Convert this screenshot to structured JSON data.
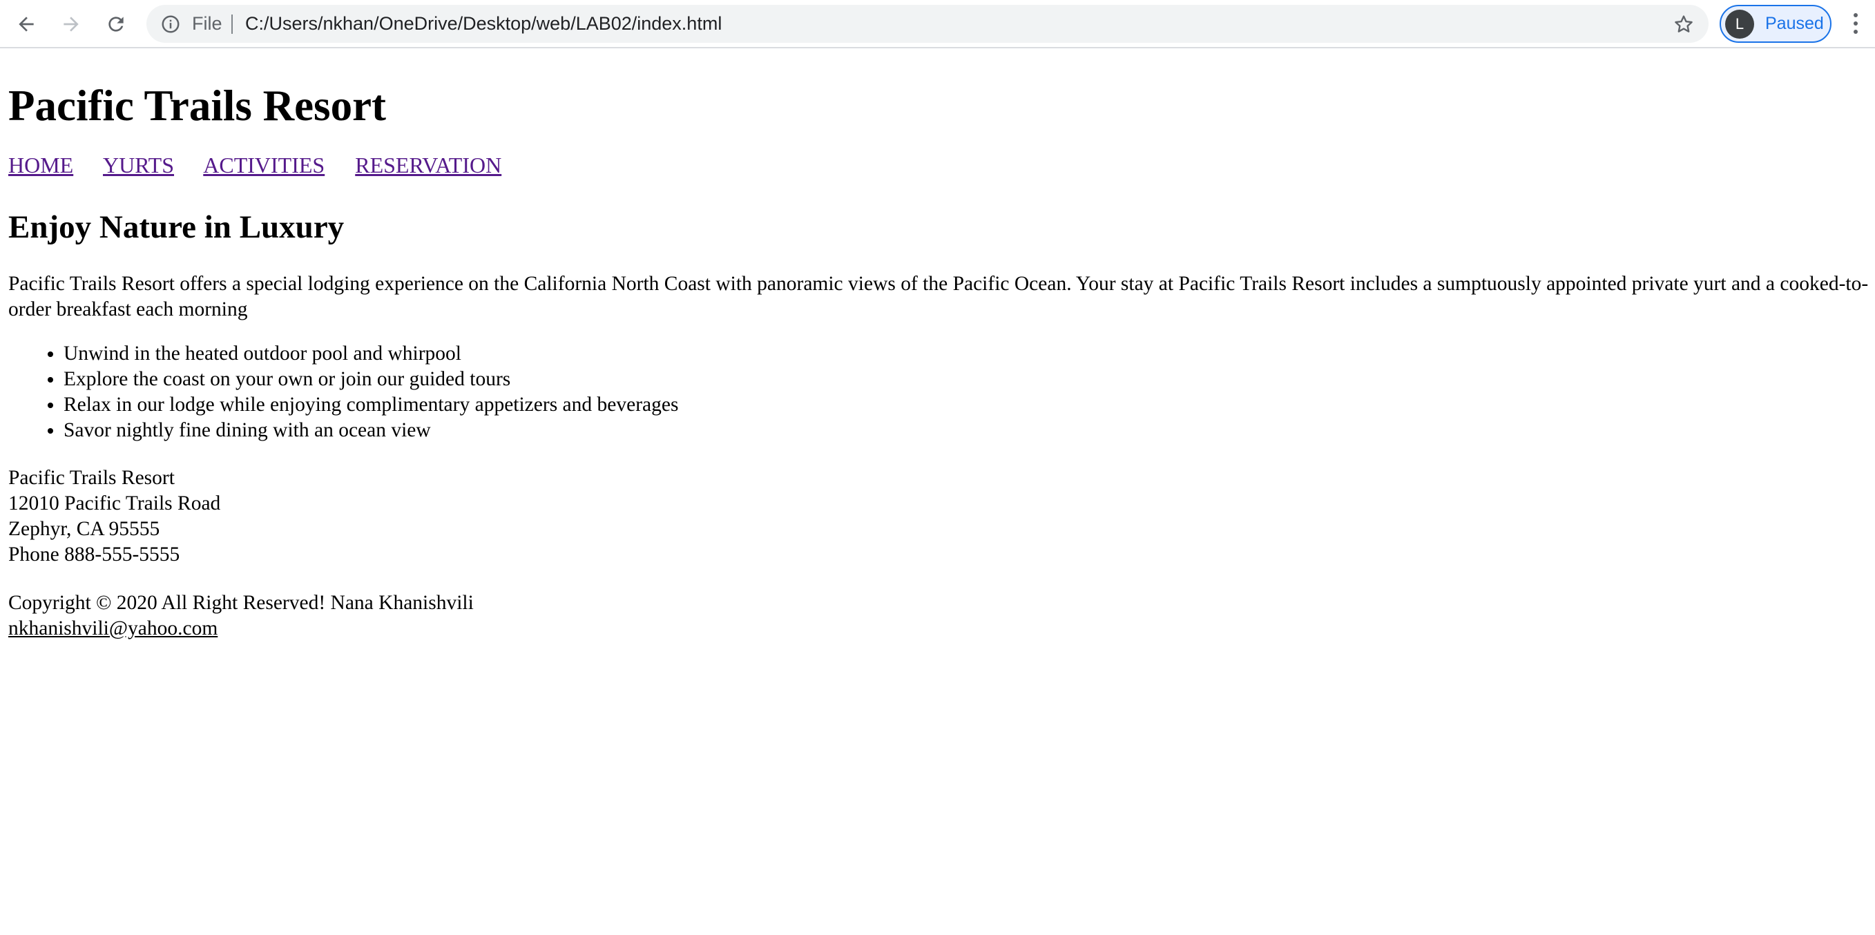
{
  "browser": {
    "file_label": "File",
    "url": "C:/Users/nkhan/OneDrive/Desktop/web/LAB02/index.html",
    "profile_initial": "L",
    "profile_status": "Paused",
    "accent_color": "#1a73e8",
    "icons": [
      "back-icon",
      "forward-icon",
      "reload-icon",
      "info-icon",
      "star-icon",
      "kebab-menu-icon"
    ]
  },
  "site": {
    "title": "Pacific Trails Resort",
    "nav": [
      "HOME",
      "YURTS",
      "ACTIVITIES",
      "RESERVATION"
    ],
    "link_color": "#551a8b"
  },
  "main": {
    "heading": "Enjoy Nature in Luxury",
    "intro": "Pacific Trails Resort offers a special lodging experience on the California North Coast with panoramic views of the Pacific Ocean. Your stay at Pacific Trails Resort includes a sumptuously appointed private yurt and a cooked-to-order breakfast each morning",
    "features": [
      "Unwind in the heated outdoor pool and whirpool",
      "Explore the coast on your own or join our guided tours",
      "Relax in our lodge while enjoying complimentary appetizers and beverages",
      "Savor nightly fine dining with an ocean view"
    ]
  },
  "address": {
    "name": "Pacific Trails Resort",
    "street": "12010 Pacific Trails Road",
    "city": "Zephyr, CA 95555",
    "phone": "Phone 888-555-5555"
  },
  "footer": {
    "copyright": "Copyright © 2020 All Right Reserved! Nana Khanishvili",
    "email": "nkhanishvili@yahoo.com"
  }
}
